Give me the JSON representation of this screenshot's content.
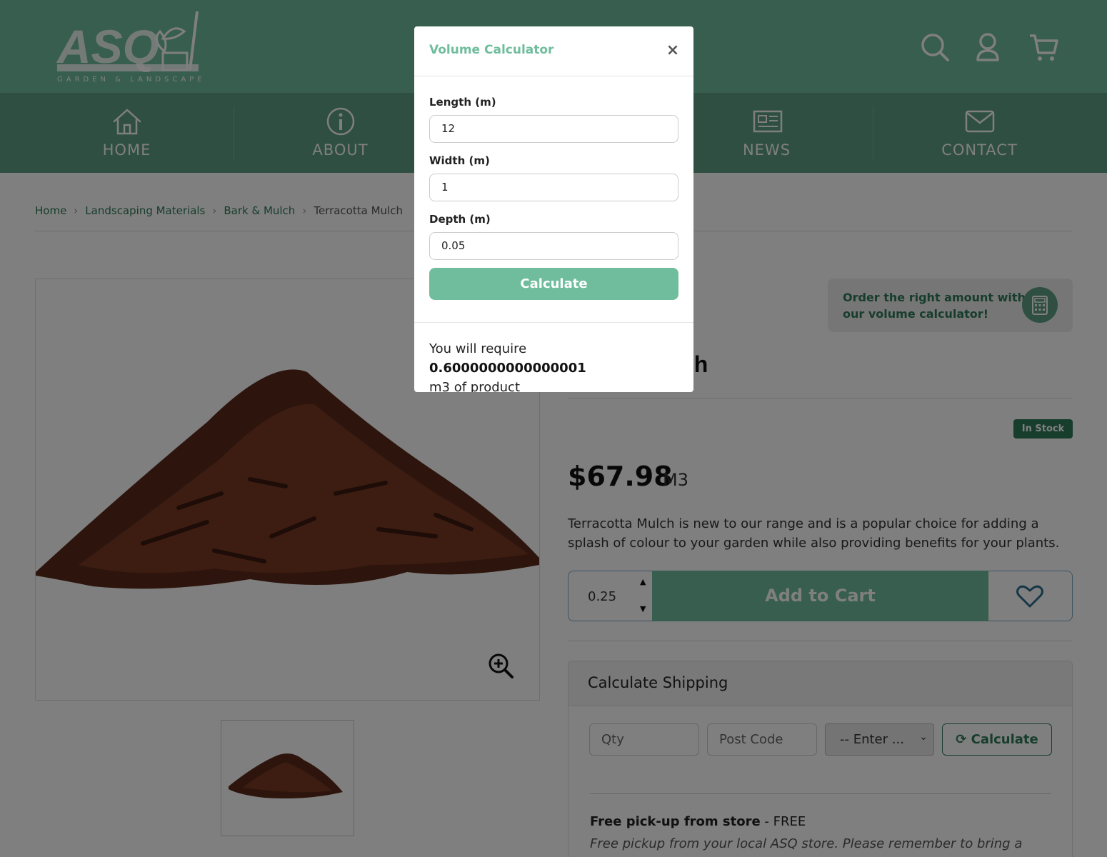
{
  "header": {
    "logo_text": "ASQ",
    "logo_sub": "GARDEN & LANDSCAPE"
  },
  "nav": [
    {
      "label": "HOME",
      "icon": "home-icon"
    },
    {
      "label": "ABOUT",
      "icon": "info-icon"
    },
    {
      "label": "",
      "icon": ""
    },
    {
      "label": "NEWS",
      "icon": "newspaper-icon"
    },
    {
      "label": "CONTACT",
      "icon": "mail-icon"
    }
  ],
  "breadcrumb": [
    "Home",
    "Landscaping Materials",
    "Bark & Mulch",
    "Terracotta Mulch"
  ],
  "promo": {
    "text": "Order the right amount with our volume calculator!"
  },
  "product": {
    "title_visible": "lch",
    "stock": "In Stock",
    "price": "$67.98",
    "unit": "M3",
    "description": "Terracotta Mulch is new to our range and is a popular choice for adding a splash of colour to your garden while also providing benefits for your plants.",
    "qty": "0.25",
    "add_to_cart": "Add to Cart"
  },
  "shipping": {
    "title": "Calculate Shipping",
    "qty_placeholder": "Qty",
    "postcode_placeholder": "Post Code",
    "select_value": "-- Enter ...",
    "calc_label": "Calculate",
    "pickup_title": "Free pick-up from store",
    "pickup_price": " - FREE",
    "pickup_note": "Free pickup from your local ASQ store. Please remember to bring a copy of your"
  },
  "modal": {
    "title": "Volume Calculator",
    "close": "×",
    "length_label": "Length (m)",
    "length_value": "12",
    "width_label": "Width (m)",
    "width_value": "1",
    "depth_label": "Depth (m)",
    "depth_value": "0.05",
    "calculate": "Calculate",
    "result_prefix": "You will require ",
    "result_value": "0.6000000000000001",
    "result_suffix": "m3 of product"
  },
  "colors": {
    "brand": "#6fbd9d",
    "nav": "#5e9e84",
    "dark": "#2f7a5b"
  }
}
